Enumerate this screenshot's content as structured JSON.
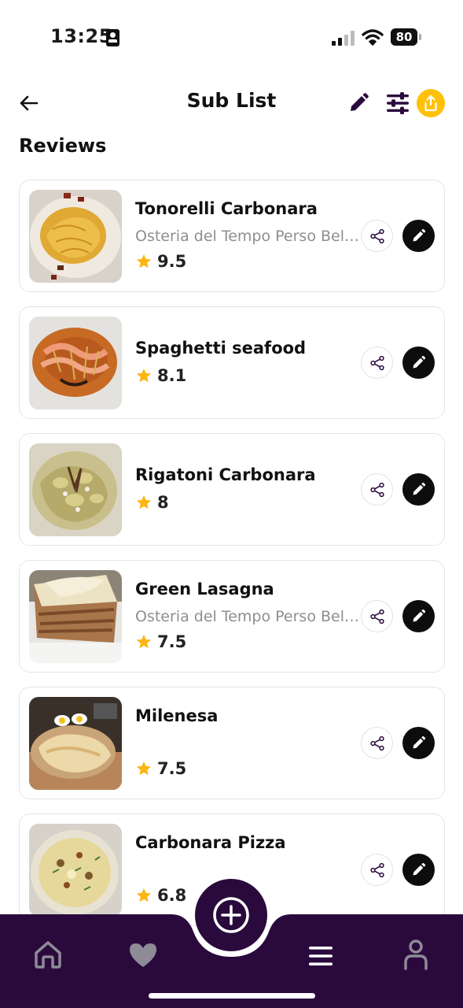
{
  "status_bar": {
    "time": "13:25",
    "battery": "80",
    "icons": [
      "id-card-icon",
      "signal-icon",
      "wifi-icon",
      "battery-icon"
    ]
  },
  "header": {
    "title": "Sub List",
    "icons": [
      "back-arrow-icon",
      "pencil-icon",
      "sliders-icon",
      "share-upload-icon"
    ]
  },
  "section_title": "Reviews",
  "reviews": [
    {
      "name": "Tonorelli Carbonara",
      "place": "Osteria del Tempo Perso Belsito",
      "rating": "9.5"
    },
    {
      "name": "Spaghetti seafood",
      "place": "",
      "rating": "8.1"
    },
    {
      "name": "Rigatoni Carbonara",
      "place": "",
      "rating": "8"
    },
    {
      "name": "Green Lasagna",
      "place": "Osteria del Tempo Perso Belsito",
      "rating": "7.5"
    },
    {
      "name": "Milenesa",
      "place": "",
      "rating": "7.5"
    },
    {
      "name": "Carbonara Pizza",
      "place": "",
      "rating": "6.8"
    }
  ],
  "bottom_nav": {
    "items": [
      "home-icon",
      "heart-icon",
      "add-circle-icon",
      "list-icon",
      "profile-icon"
    ],
    "active": "list-icon"
  },
  "colors": {
    "accent": "#FFC107",
    "nav_background": "#2a0a3d",
    "star": "#FDB515",
    "edit_button": "#0d0d0d",
    "header_icons": "#2a0a3d"
  }
}
